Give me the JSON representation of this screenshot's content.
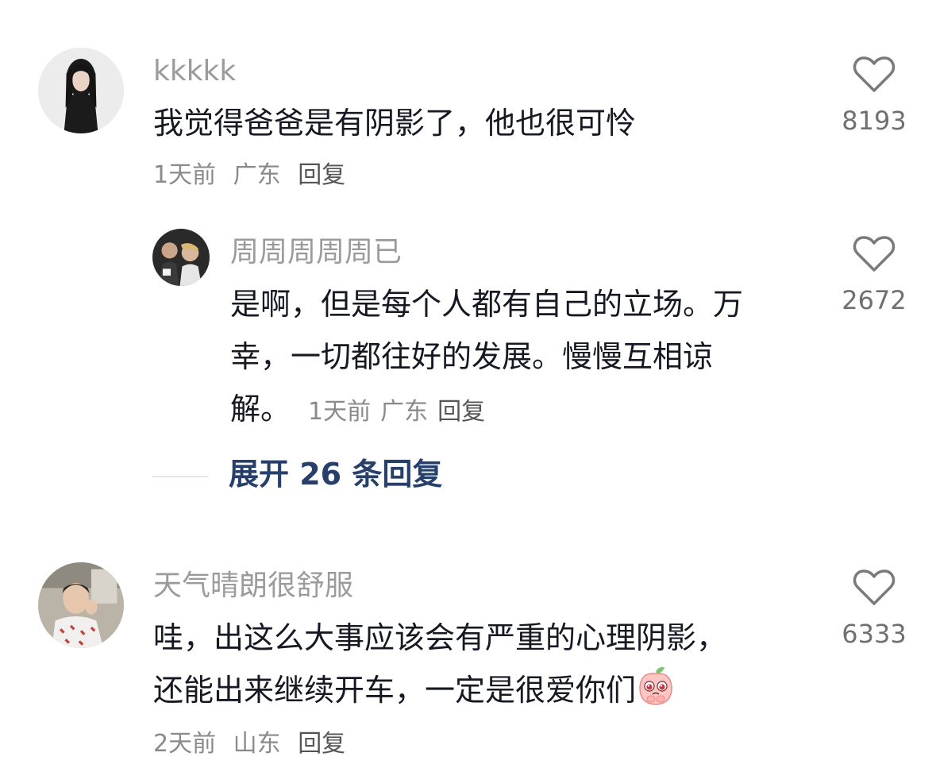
{
  "comments": [
    {
      "username": "kkkkk",
      "text": "我觉得爸爸是有阴影了，他也很可怜",
      "time": "1天前",
      "location": "广东",
      "reply_label": "回复",
      "likes": "8193",
      "avatar_icon": "avatar-woman-dark-hair",
      "replies": [
        {
          "username": "周周周周周已",
          "text": "是啊，但是每个人都有自己的立场。万幸，一切都往好的发展。慢慢互相谅解。",
          "line1": "是啊，但是每个人都有自己的立场。万",
          "line2": "幸，一切都往好的发展。慢慢互相谅",
          "line3": "解。",
          "time": "1天前",
          "location": "广东",
          "reply_label": "回复",
          "likes": "2672",
          "avatar_icon": "avatar-group-photo"
        }
      ],
      "expand_label": "展开 26 条回复"
    },
    {
      "username": "天气晴朗很舒服",
      "line1": "哇，出这么大事应该会有严重的心理阴影，",
      "line2": "还能出来继续开车，一定是很爱你们",
      "emoji_icon": "peach-pleading-emoji",
      "time": "2天前",
      "location": "山东",
      "reply_label": "回复",
      "likes": "6333",
      "avatar_icon": "avatar-young-man-in-car"
    }
  ],
  "colors": {
    "username": "#9b9b9b",
    "text": "#161823",
    "meta": "#8a8a8a",
    "expand_link": "#26406b",
    "like_icon": "#7a7a7a"
  }
}
